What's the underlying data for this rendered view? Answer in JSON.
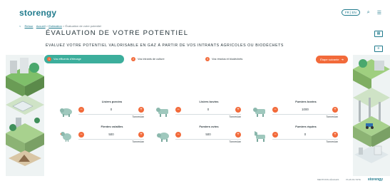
{
  "header": {
    "logo": "storengy",
    "lang": "FR | EN",
    "search_icon": "search-icon",
    "menu_icon": "menu-icon"
  },
  "breadcrumb": {
    "back": "<",
    "items": [
      "Retour",
      "Accueil",
      "Estimation",
      "Évaluation de votre potentiel"
    ]
  },
  "page": {
    "title": "ÉVALUATION DE VOTRE POTENTIEL",
    "subtitle": "ÉVALUEZ VOTRE POTENTIEL VALORISABLE EN GAZ À PARTIR DE VOS INTRANTS AGRICOLES OU BIODÉCHETS"
  },
  "steps": [
    {
      "num": "1",
      "label": "Vos effluents d'élevage"
    },
    {
      "num": "2",
      "label": "Vos intrants de culture"
    },
    {
      "num": "3",
      "label": "Vos résidus et biodéchets"
    }
  ],
  "next_button": {
    "label": "Étape suivante",
    "arrow": "➔"
  },
  "cards": [
    {
      "label": "Lisiers porcins",
      "value": "0",
      "unit": "Tonnes/an",
      "icon_caption": ""
    },
    {
      "label": "Lisiers bovins",
      "value": "0",
      "unit": "Tonnes/an",
      "icon_caption": ""
    },
    {
      "label": "Fumiers bovins",
      "value": "1000",
      "unit": "Tonnes/an",
      "icon_caption": ""
    },
    {
      "label": "Fientes volailles",
      "value": "500",
      "unit": "Tonnes/an",
      "icon_caption": ""
    },
    {
      "label": "Fumiers ovins",
      "value": "500",
      "unit": "Tonnes/an",
      "icon_caption": ""
    },
    {
      "label": "Fumiers équins",
      "value": "0",
      "unit": "Tonnes/an",
      "icon_caption": ""
    }
  ],
  "footer": {
    "link1": "MENTIONS LÉGALES",
    "link2": "PLAN DU SITE",
    "brand": "storengy"
  },
  "colors": {
    "accent": "#f26a3a",
    "teal": "#3cae9c",
    "brand": "#1f7a8c"
  }
}
